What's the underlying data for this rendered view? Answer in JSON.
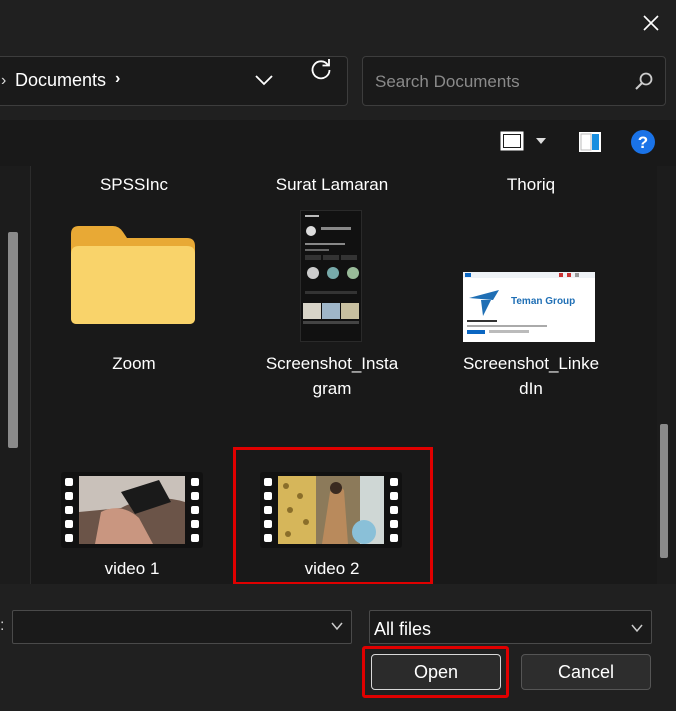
{
  "window": {
    "close_icon": "close-icon"
  },
  "address": {
    "current_folder": "Documents",
    "separator": "›"
  },
  "search": {
    "placeholder": "Search Documents"
  },
  "files": {
    "row1": [
      "SPSSInc",
      "Surat Lamaran",
      "Thoriq"
    ],
    "zoom": "Zoom",
    "screenshot_instagram": [
      "Screenshot_Insta",
      "gram"
    ],
    "screenshot_linkedin": [
      "Screenshot_Linke",
      "dIn"
    ],
    "linkedin_thumb_text": "Teman Group",
    "video1": "video 1",
    "video2": "video 2"
  },
  "bottom": {
    "filename_label": ":",
    "filename_value": "",
    "filetype_value": "All files",
    "open_label": "Open",
    "cancel_label": "Cancel"
  },
  "colors": {
    "highlight": "#e00000",
    "help": "#1a73e8",
    "folder": "#f5c542"
  }
}
